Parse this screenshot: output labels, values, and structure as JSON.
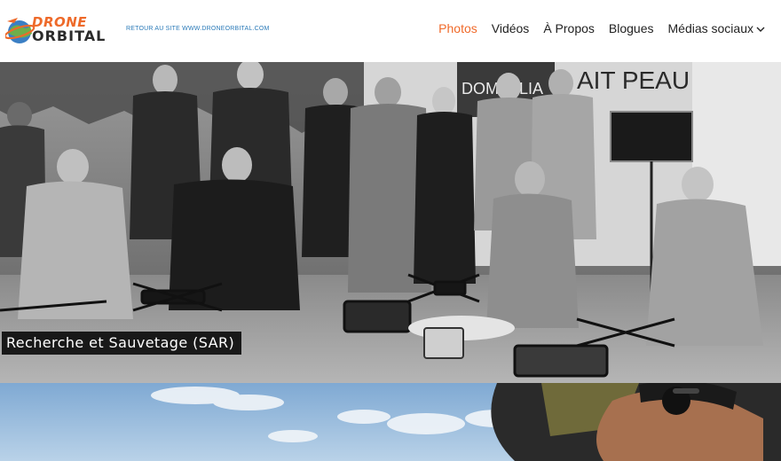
{
  "header": {
    "logo": {
      "line1": "DRONE",
      "line2": "ORBITAL"
    },
    "back_link": "RETOUR AU SITE WWW.DRONEORBITAL.COM"
  },
  "nav": {
    "items": [
      {
        "label": "Photos",
        "active": true
      },
      {
        "label": "Vidéos"
      },
      {
        "label": "À Propos"
      },
      {
        "label": "Blogues"
      },
      {
        "label": "Médias sociaux"
      }
    ]
  },
  "hero": {
    "caption": "Recherche et Sauvetage (SAR)",
    "banner_text": "DOMICILIA",
    "banner_text2": "AIT PEAU"
  },
  "colors": {
    "accent": "#f06a2a",
    "link": "#2a7ab8"
  }
}
